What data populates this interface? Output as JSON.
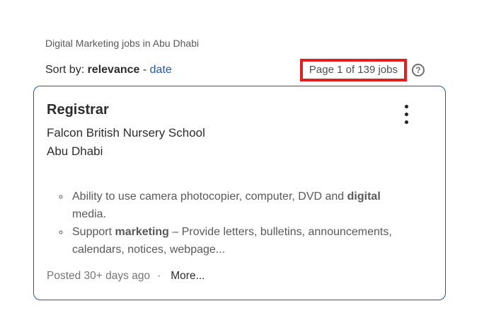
{
  "header": {
    "breadcrumb": "Digital Marketing jobs in Abu Dhabi"
  },
  "sort_bar": {
    "sort_label": "Sort by: ",
    "relevance_label": "relevance",
    "separator": " - ",
    "date_label": "date",
    "page_info": "Page 1 of 139 jobs",
    "help_icon_glyph": "?"
  },
  "job_card": {
    "title": "Registrar",
    "company": "Falcon British Nursery School",
    "location": "Abu Dhabi",
    "bullets": [
      {
        "pre": "Ability to use camera photocopier, computer, DVD and ",
        "bold": "digital",
        "post": " media."
      },
      {
        "pre": "Support ",
        "bold": "marketing",
        "post": " – Provide letters, bulletins, announcements, calendars, notices, webpage..."
      }
    ],
    "posted": "Posted 30+ days ago",
    "dot_separator": "·",
    "more_label": "More..."
  },
  "colors": {
    "accent_blue": "#2557a7",
    "highlight_red": "#e02020",
    "text_dark": "#2d2d2d",
    "text_gray": "#595959",
    "muted_gray": "#767676"
  }
}
